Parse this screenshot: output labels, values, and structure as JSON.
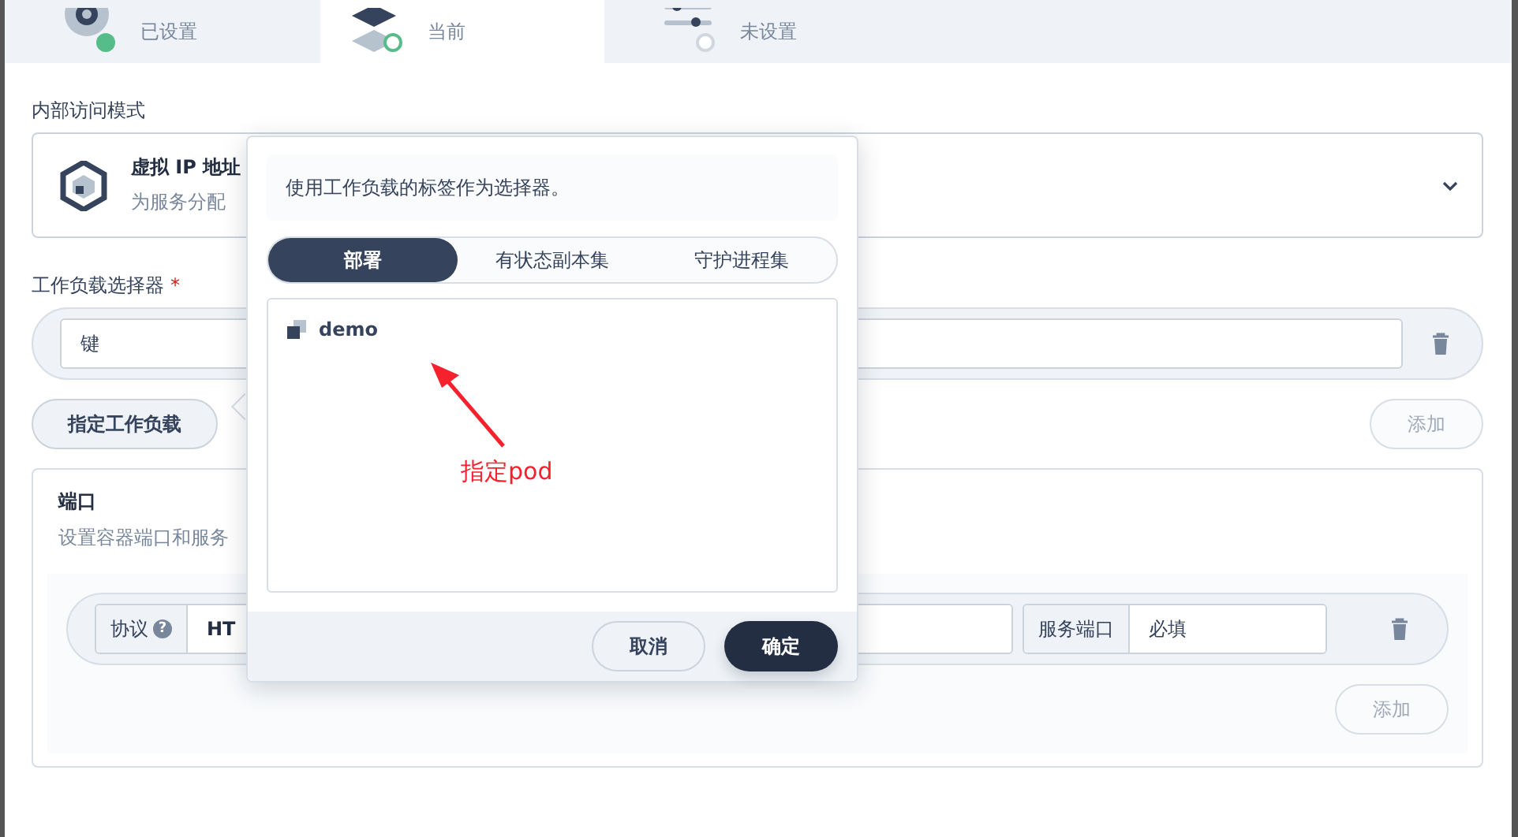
{
  "steps": [
    {
      "status": "已设置",
      "kind": "done"
    },
    {
      "status": "当前",
      "kind": "current"
    },
    {
      "status": "未设置",
      "kind": "todo"
    }
  ],
  "access_mode": {
    "label": "内部访问模式",
    "option_title": "虚拟 IP 地址",
    "option_desc": "为服务分配"
  },
  "selector": {
    "label": "工作负载选择器",
    "required_mark": "*",
    "key_placeholder": "键",
    "specify_button": "指定工作负载",
    "add_button": "添加"
  },
  "ports": {
    "title": "端口",
    "desc": "设置容器端口和服务",
    "protocol_label": "协议",
    "protocol_help": "?",
    "protocol_value": "HT",
    "service_port_label": "服务端口",
    "service_port_placeholder": "必填",
    "add_button": "添加"
  },
  "popover": {
    "hint": "使用工作负载的标签作为选择器。",
    "tabs": [
      {
        "label": "部署",
        "selected": true
      },
      {
        "label": "有状态副本集",
        "selected": false
      },
      {
        "label": "守护进程集",
        "selected": false
      }
    ],
    "items": [
      {
        "name": "demo"
      }
    ],
    "cancel": "取消",
    "confirm": "确定"
  },
  "annotation": {
    "text": "指定pod"
  }
}
